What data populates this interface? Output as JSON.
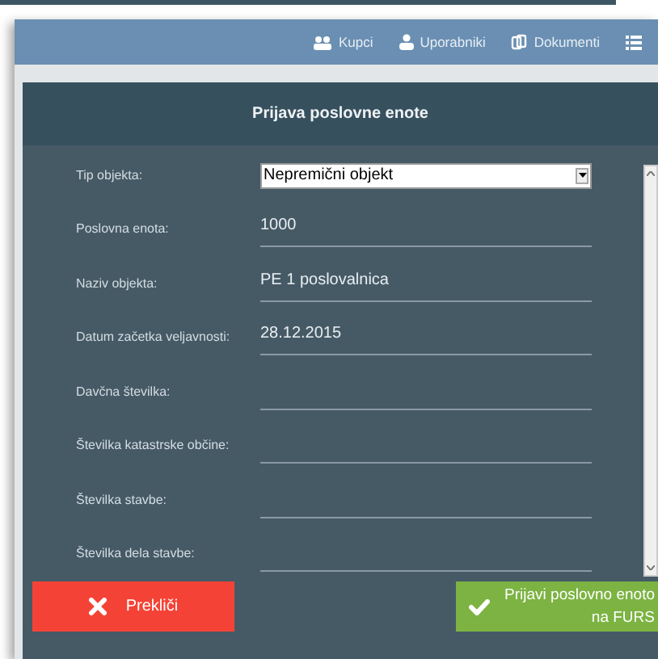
{
  "nav": [
    {
      "label": "Kupci",
      "kind": "users"
    },
    {
      "label": "Uporabniki",
      "kind": "user"
    },
    {
      "label": "Dokumenti",
      "kind": "docs"
    },
    {
      "kind": "list"
    }
  ],
  "dialog": {
    "title": "Prijava poslovne enote",
    "fields": [
      {
        "kind": "select",
        "label": "Tip objekta:",
        "value": "Nepremični objekt"
      },
      {
        "kind": "text",
        "label": "Poslovna enota:",
        "value": "1000"
      },
      {
        "kind": "text",
        "label": "Naziv objekta:",
        "value": "PE 1 poslovalnica"
      },
      {
        "kind": "text",
        "label": "Datum začetka veljavnosti:",
        "value": "28.12.2015"
      },
      {
        "kind": "text",
        "label": "Davčna številka:"
      },
      {
        "kind": "text",
        "label": "Številka katastrske občine:"
      },
      {
        "kind": "text",
        "label": "Številka stavbe:"
      },
      {
        "kind": "text",
        "label": "Številka dela stavbe:"
      }
    ],
    "cancel": "Prekliči",
    "submit": "Prijavi poslovno enoto na FURS"
  }
}
